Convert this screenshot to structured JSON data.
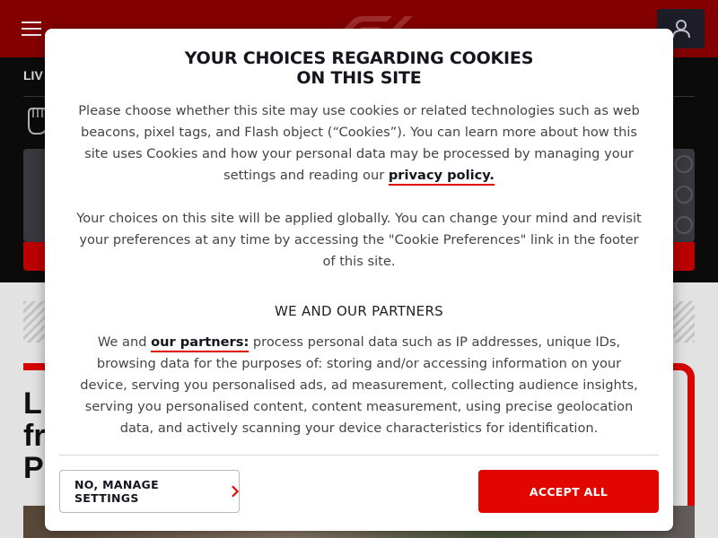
{
  "background": {
    "live_label": "LIV",
    "headline_fragment": "L\nfr\nP"
  },
  "cookie_dialog": {
    "title_line1": "YOUR CHOICES REGARDING COOKIES",
    "title_line2": "ON THIS SITE",
    "intro_before_link": "Please choose whether this site may use cookies or related technologies such as web beacons, pixel tags, and Flash object (“Cookies”). You can learn more about how this site uses Cookies and how your personal data may be processed by managing your settings and reading our ",
    "privacy_link": "privacy policy.",
    "global_choices": "Your choices on this site will be applied globally. You can change your mind and revisit your preferences at any time by accessing the \"Cookie Preferences\" link in the footer of this site.",
    "partners_heading": "WE AND OUR PARTNERS",
    "partners_before_link": "We and ",
    "partners_link": "our partners:",
    "partners_after_link": " process personal data such as IP addresses, unique IDs, browsing data for the purposes of: storing and/or accessing information on your device, serving you personalised ads, ad measurement, collecting audience insights, serving you personalised content, content measurement, using precise geolocation data, and actively scanning your device characteristics for identification.",
    "manage_button": "NO, MANAGE SETTINGS",
    "accept_button": "ACCEPT ALL"
  },
  "colors": {
    "brand_red": "#e10600",
    "header_dark_red": "#8c0000",
    "text_dark": "#15151e"
  },
  "icons": {
    "menu": "hamburger-icon",
    "user": "user-icon",
    "chevron": "chevron-right-icon"
  }
}
